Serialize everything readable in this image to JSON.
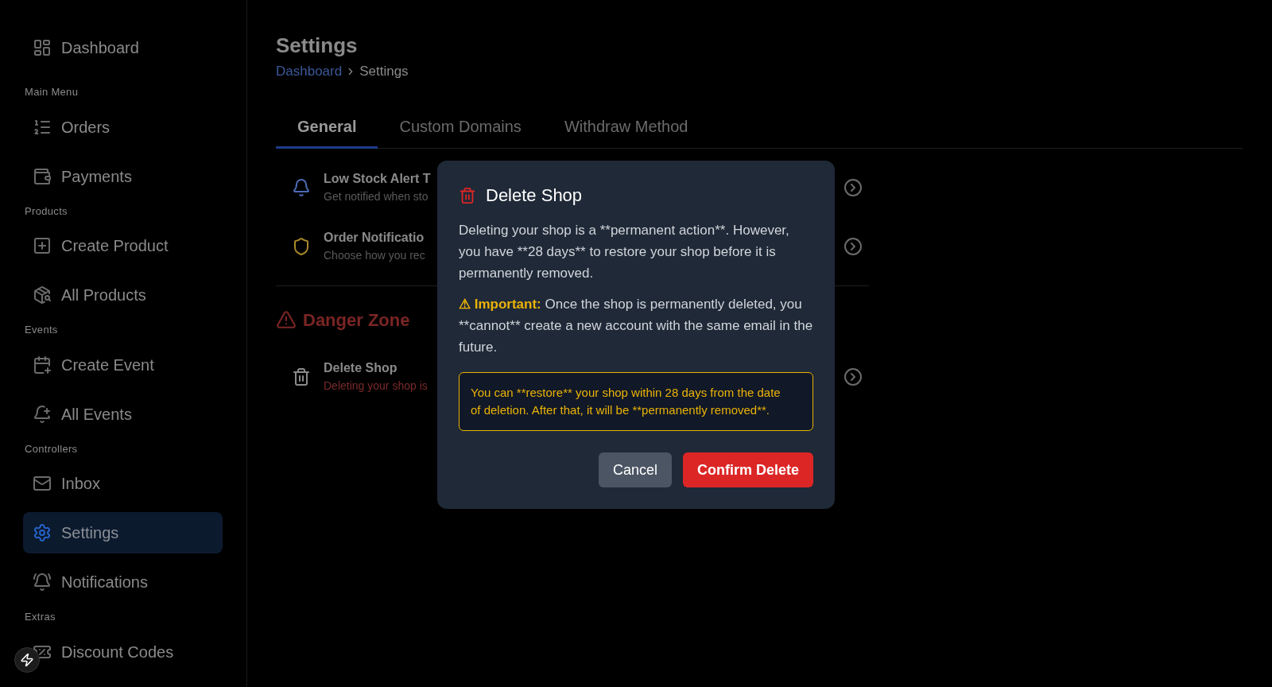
{
  "sidebar": {
    "top": {
      "label": "Dashboard",
      "selected": false
    },
    "sections": [
      {
        "title": "Main Menu",
        "items": [
          {
            "label": "Orders",
            "selected": false
          },
          {
            "label": "Payments",
            "selected": false
          }
        ]
      },
      {
        "title": "Products",
        "items": [
          {
            "label": "Create Product",
            "selected": false
          },
          {
            "label": "All Products",
            "selected": false
          }
        ]
      },
      {
        "title": "Events",
        "items": [
          {
            "label": "Create Event",
            "selected": false
          },
          {
            "label": "All Events",
            "selected": false
          }
        ]
      },
      {
        "title": "Controllers",
        "items": [
          {
            "label": "Inbox",
            "selected": false
          },
          {
            "label": "Settings",
            "selected": true
          },
          {
            "label": "Notifications",
            "selected": false
          }
        ]
      },
      {
        "title": "Extras",
        "items": [
          {
            "label": "Discount Codes",
            "selected": false
          }
        ]
      }
    ]
  },
  "page": {
    "title": "Settings",
    "breadcrumb": [
      {
        "label": "Dashboard",
        "kind": "link"
      },
      {
        "label": "Settings",
        "kind": "current"
      }
    ]
  },
  "tabs": [
    {
      "label": "General",
      "selected": true
    },
    {
      "label": "Custom Domains",
      "selected": false
    },
    {
      "label": "Withdraw Method",
      "selected": false
    }
  ],
  "settings": [
    {
      "title": "Low Stock Alert T",
      "subtitle": "Get notified when sto"
    },
    {
      "title": "Order Notificatio",
      "subtitle": "Choose how you rec"
    }
  ],
  "danger_zone": {
    "title": "Danger Zone",
    "items": [
      {
        "title": "Delete Shop",
        "subtitle": "Deleting your shop is"
      }
    ]
  },
  "dialog": {
    "title": "Delete Shop",
    "body": "Deleting your shop is a **permanent action**. However, you have **28 days** to restore your shop before it is permanently removed.",
    "warning_label": "⚠ Important:",
    "warning_text": "Once the shop is permanently deleted, you **cannot** create a new account with the same email in the future.",
    "notice": "You can **restore** your shop within 28 days from the date of deletion. After that, it will be **permanently removed**.",
    "buttons": [
      {
        "label": "Cancel",
        "kind": "secondary"
      },
      {
        "label": "Confirm Delete",
        "kind": "danger"
      }
    ]
  }
}
